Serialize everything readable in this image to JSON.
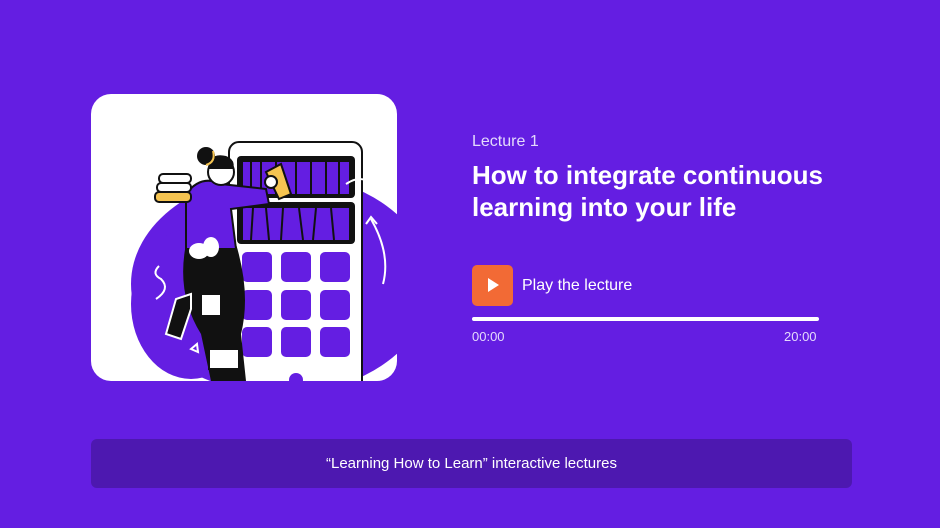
{
  "lecture": {
    "number_label": "Lecture 1",
    "title": "How to integrate continuous learning into your life"
  },
  "player": {
    "play_label": "Play the lecture",
    "current_time": "00:00",
    "duration": "20:00",
    "progress": 0,
    "icon": "play-icon"
  },
  "footer": {
    "text": "“Learning How to Learn” interactive lectures"
  },
  "colors": {
    "background": "#641ee2",
    "accent": "#f26a35",
    "footer_bg": "#4d18b0"
  }
}
